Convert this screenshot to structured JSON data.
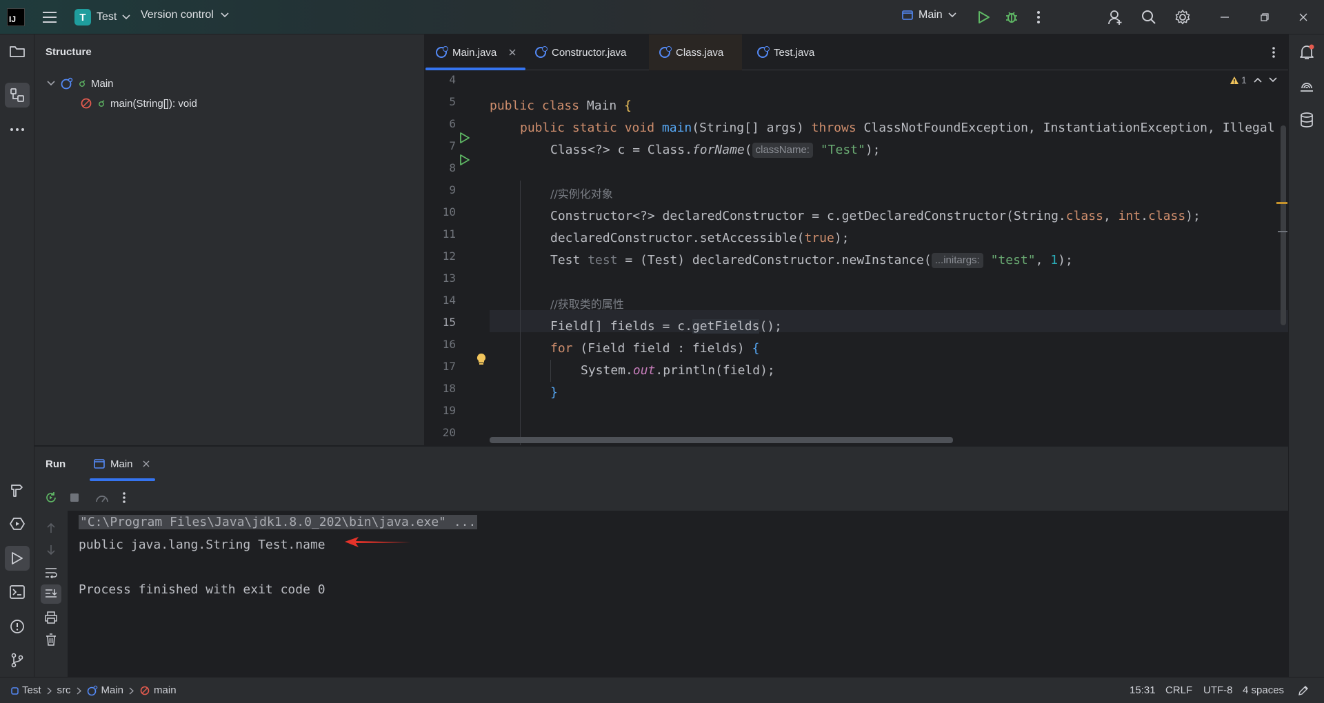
{
  "titlebar": {
    "logo_text": "IJ",
    "project_badge": "T",
    "project_name": "Test",
    "vcs_label": "Version control",
    "run_config": "Main"
  },
  "structure": {
    "title": "Structure",
    "tree": [
      {
        "label": "Main"
      },
      {
        "label": "main(String[]): void"
      }
    ]
  },
  "editor": {
    "tabs": [
      {
        "label": "Main.java",
        "active": true
      },
      {
        "label": "Constructor.java"
      },
      {
        "label": "Class.java"
      },
      {
        "label": "Test.java"
      }
    ],
    "warning_count": "1",
    "line_numbers": [
      "4",
      "5",
      "6",
      "7",
      "8",
      "9",
      "10",
      "11",
      "12",
      "13",
      "14",
      "15",
      "16",
      "17",
      "18",
      "19",
      "20"
    ],
    "current_line": "15",
    "code": {
      "l5": [
        "public class ",
        "Main ",
        "{"
      ],
      "l6": [
        "public static void ",
        "main",
        "(String[] args) ",
        "throws ",
        "ClassNotFoundException, InstantiationException, Illegal"
      ],
      "l7": [
        "Class<?> c = Class.",
        "forName",
        "(",
        "className:",
        "\"Test\"",
        ");"
      ],
      "l9": "//实例化对象",
      "l10": [
        "Constructor<?> declaredConstructor = c.getDeclaredConstructor(String.",
        "class",
        ", ",
        "int",
        ".",
        "class",
        ");"
      ],
      "l11": [
        "declaredConstructor.setAccessible(",
        "true",
        ");"
      ],
      "l12": [
        "Test ",
        "test",
        " = (Test) declaredConstructor.newInstance(",
        "...initargs:",
        "\"test\"",
        ", ",
        "1",
        ");"
      ],
      "l14": "//获取类的属性",
      "l15": [
        "Field[] fields = c.",
        "getFields",
        "();"
      ],
      "l16": [
        "for ",
        "(Field field : fields) ",
        "{"
      ],
      "l17": [
        "System.",
        "out",
        ".println(field);"
      ],
      "l18": "}"
    }
  },
  "run": {
    "label": "Run",
    "tab_label": "Main",
    "console": [
      "\"C:\\Program Files\\Java\\jdk1.8.0_202\\bin\\java.exe\" ...",
      "public java.lang.String Test.name",
      "",
      "Process finished with exit code 0"
    ]
  },
  "statusbar": {
    "breadcrumb": [
      "Test",
      "src",
      "Main",
      "main"
    ],
    "position": "15:31",
    "line_sep": "CRLF",
    "encoding": "UTF-8",
    "indent": "4 spaces"
  },
  "colors": {
    "accent": "#3574f0",
    "keyword": "#cf8e6d",
    "function": "#56a8f5",
    "string": "#6aab73",
    "number": "#2aacb8",
    "run_green": "#5fb865",
    "arrow_red": "#e5332a"
  },
  "icons": [
    "folder-icon",
    "structure-icon",
    "more-icon",
    "hammer-icon",
    "services-icon",
    "run-icon",
    "terminal-icon",
    "problems-icon",
    "git-icon",
    "bell-icon",
    "ai-icon",
    "database-icon",
    "search-icon",
    "gear-icon",
    "add-user-icon",
    "debug-icon"
  ]
}
